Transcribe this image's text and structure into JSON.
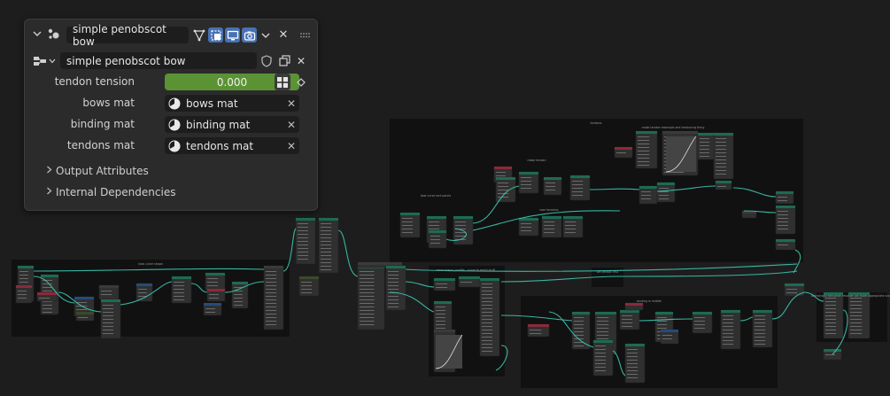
{
  "panel": {
    "modifier_name": "simple penobscot bow",
    "node_group_name": "simple penobscot bow",
    "close_glyph": "✕",
    "inputs": {
      "tendon_tension": {
        "label": "tendon tension",
        "value": "0.000"
      },
      "materials": [
        {
          "label": "bows mat",
          "value": "bows mat"
        },
        {
          "label": "binding mat",
          "value": "binding mat"
        },
        {
          "label": "tendons mat",
          "value": "tendons mat"
        }
      ]
    },
    "subpanels": [
      {
        "label": "Output Attributes"
      },
      {
        "label": "Internal Dependencies"
      }
    ]
  },
  "icons": {
    "collapse": "chevron-down-icon",
    "modifier": "geometry-nodes-icon",
    "edit_mode": "vertex-triangle-icon",
    "on_cage": "cage-icon",
    "viewport": "monitor-icon",
    "render": "camera-icon",
    "more": "drag-handle-icon",
    "node_tree": "node-tree-icon",
    "fake_user": "shield-icon",
    "duplicate": "duplicate-icon",
    "material": "material-sphere-icon",
    "keyframe": "keyframe-diamond-icon"
  },
  "colors": {
    "editor_bg": "#1d1d1d",
    "frame_bg": "#111111",
    "node_bg": "#303030",
    "wire": "#3dc7b0",
    "slider_green": "#5b9334",
    "accent_blue": "#4772b3",
    "header_geo": "#1c6b52",
    "header_input": "#8a2a3a",
    "header_converter": "#244c7c",
    "header_group": "#3a4a2a"
  },
  "frames": [
    {
      "label": "bow curve shape"
    },
    {
      "label": "tendons"
    },
    {
      "label": "make tendon"
    },
    {
      "label": "bow curve end points"
    },
    {
      "label": "user tensions"
    },
    {
      "label": "make tendon resample and tensioning thing"
    },
    {
      "label": "lower tendon to resample"
    },
    {
      "label": "base shape / profile - curve to mesh stuff"
    },
    {
      "label": "set tendon rest"
    },
    {
      "label": "binding in middle"
    },
    {
      "label": "brimshaply tensioner resolver set more appropriate scale"
    },
    {
      "label": "string profile"
    },
    {
      "label": "set strings mat"
    },
    {
      "label": "set binding mat"
    },
    {
      "label": "base curve"
    },
    {
      "label": "base tendon in binding thing"
    },
    {
      "label": "base mat mats"
    }
  ]
}
